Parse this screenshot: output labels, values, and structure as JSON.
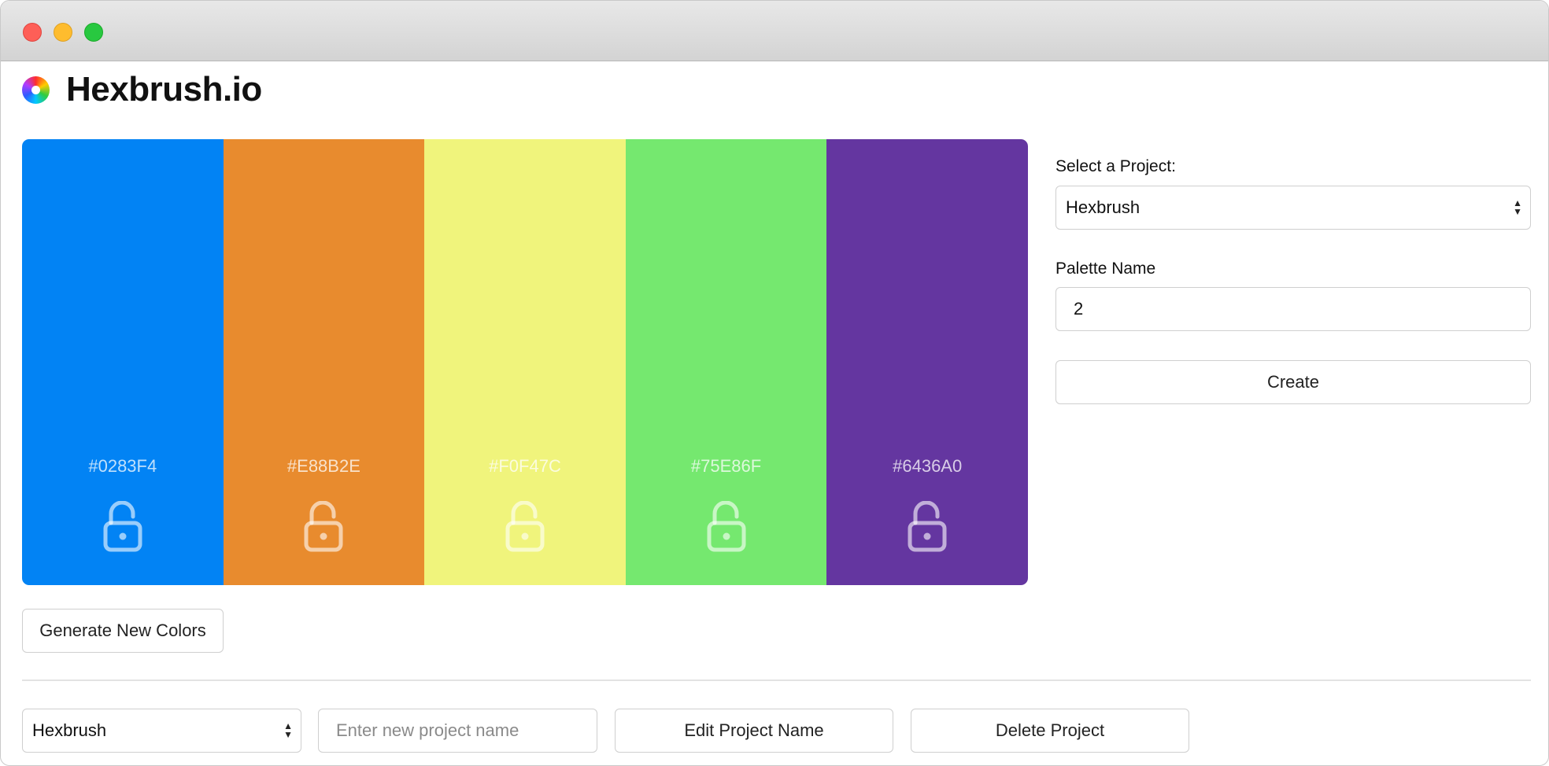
{
  "app": {
    "title": "Hexbrush.io"
  },
  "palette": {
    "swatches": [
      {
        "hex": "#0283F4",
        "color": "#0283F4"
      },
      {
        "hex": "#E88B2E",
        "color": "#E88B2E"
      },
      {
        "hex": "#F0F47C",
        "color": "#F0F47C"
      },
      {
        "hex": "#75E86F",
        "color": "#75E86F"
      },
      {
        "hex": "#6436A0",
        "color": "#6436A0"
      }
    ],
    "lock_icon": "unlocked-padlock-icon"
  },
  "form": {
    "project_label": "Select a Project:",
    "project_value": "Hexbrush",
    "palette_name_label": "Palette Name",
    "palette_name_value": "2",
    "create_label": "Create"
  },
  "actions": {
    "generate_label": "Generate New Colors"
  },
  "project_bar": {
    "project_value": "Hexbrush",
    "new_name_placeholder": "Enter new project name",
    "edit_label": "Edit Project Name",
    "delete_label": "Delete Project"
  }
}
